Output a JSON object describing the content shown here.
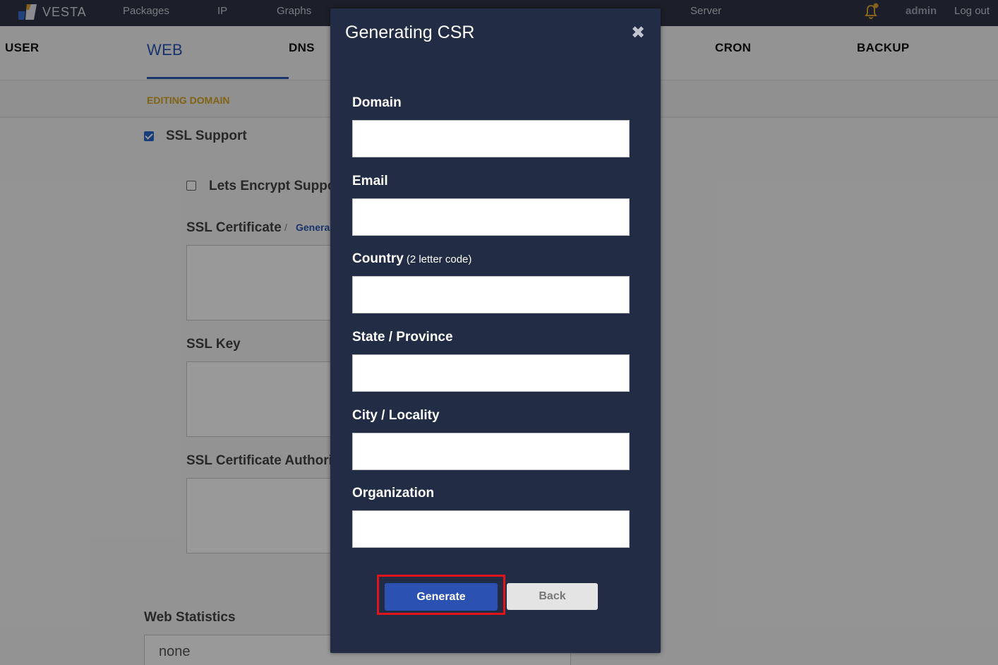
{
  "topbar": {
    "logo": "VESTA",
    "nav": [
      "Packages",
      "IP",
      "Graphs",
      "Server"
    ],
    "user": "admin",
    "logout": "Log out"
  },
  "tabs": {
    "user": "USER",
    "web": "WEB",
    "dns": "DNS",
    "cron": "CRON",
    "backup": "BACKUP"
  },
  "subbar": {
    "editing": "EDITING DOMAIN"
  },
  "form": {
    "ssl_support": "SSL Support",
    "lets_encrypt": "Lets Encrypt Suppo",
    "ssl_certificate": "SSL Certificate",
    "generate_link": "Genera",
    "ssl_key": "SSL Key",
    "ssl_ca": "SSL Certificate Authori",
    "web_statistics": "Web Statistics",
    "web_statistics_value": "none"
  },
  "modal": {
    "title": "Generating CSR",
    "close": "✖",
    "fields": {
      "domain": {
        "label": "Domain",
        "value": ""
      },
      "email": {
        "label": "Email",
        "value": ""
      },
      "country": {
        "label": "Country",
        "hint": "(2 letter code)",
        "value": ""
      },
      "state": {
        "label": "State / Province",
        "value": ""
      },
      "city": {
        "label": "City / Locality",
        "value": ""
      },
      "org": {
        "label": "Organization",
        "value": ""
      }
    },
    "generate": "Generate",
    "back": "Back"
  },
  "colors": {
    "topbar": "#2f3545",
    "accent": "#2a55b3",
    "modal_bg": "#222d45",
    "highlight": "#e0151c",
    "editing_label": "#d6a521"
  }
}
